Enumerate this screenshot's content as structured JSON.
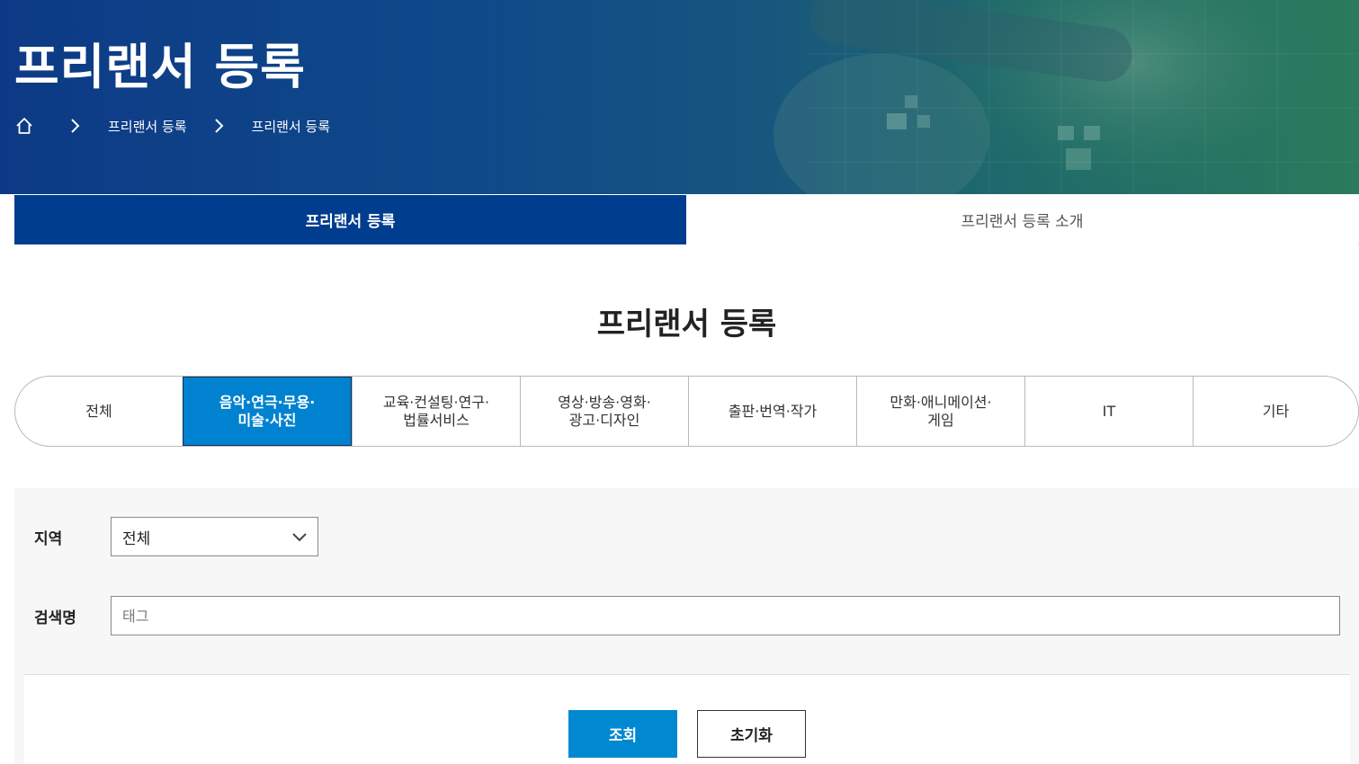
{
  "hero": {
    "title": "프리랜서 등록",
    "breadcrumb": [
      "프리랜서 등록",
      "프리랜서 등록"
    ],
    "home_icon": "home-icon",
    "separator_icon": "chevron-right-icon"
  },
  "tabs": [
    {
      "label": "프리랜서 등록",
      "active": true
    },
    {
      "label": "프리랜서 등록 소개",
      "active": false
    }
  ],
  "section_title": "프리랜서 등록",
  "categories": [
    {
      "label": "전체"
    },
    {
      "label": "음악·연극·무용·\n미술·사진",
      "active": true
    },
    {
      "label": "교육·컨설팅·연구·\n법률서비스"
    },
    {
      "label": "영상·방송·영화·\n광고·디자인"
    },
    {
      "label": "출판·번역·작가"
    },
    {
      "label": "만화·애니메이션·\n게임"
    },
    {
      "label": "IT"
    },
    {
      "label": "기타"
    }
  ],
  "search": {
    "region_label": "지역",
    "region_value": "전체",
    "keyword_label": "검색명",
    "keyword_placeholder": "태그",
    "submit_label": "조회",
    "reset_label": "초기화"
  },
  "colors": {
    "primary_navy": "#003d8f",
    "active_blue": "#0082d0",
    "button_blue": "#0088d1"
  }
}
